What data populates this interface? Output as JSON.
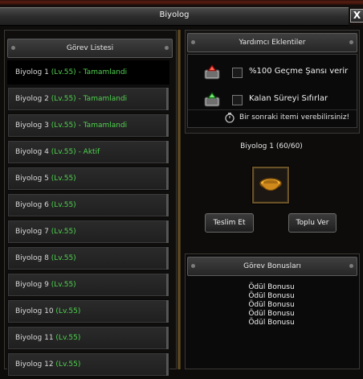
{
  "window": {
    "title": "Biyolog",
    "close_label": "X"
  },
  "left": {
    "header": "Görev Listesi",
    "quests": [
      {
        "name": "Biyolog 1",
        "level": "(Lv.55)",
        "status": "- Tamamlandi"
      },
      {
        "name": "Biyolog 2",
        "level": "(Lv.55)",
        "status": "- Tamamlandi"
      },
      {
        "name": "Biyolog 3",
        "level": "(Lv.55)",
        "status": "- Tamamlandi"
      },
      {
        "name": "Biyolog 4",
        "level": "(Lv.55)",
        "status": "- Aktif"
      },
      {
        "name": "Biyolog 5",
        "level": "(Lv.55)",
        "status": ""
      },
      {
        "name": "Biyolog 6",
        "level": "(Lv.55)",
        "status": ""
      },
      {
        "name": "Biyolog 7",
        "level": "(Lv.55)",
        "status": ""
      },
      {
        "name": "Biyolog 8",
        "level": "(Lv.55)",
        "status": ""
      },
      {
        "name": "Biyolog 9",
        "level": "(Lv.55)",
        "status": ""
      },
      {
        "name": "Biyolog 10",
        "level": "(Lv.55)",
        "status": ""
      },
      {
        "name": "Biyolog 11",
        "level": "(Lv.55)",
        "status": ""
      },
      {
        "name": "Biyolog 12",
        "level": "(Lv.55)",
        "status": ""
      }
    ]
  },
  "helpers": {
    "header": "Yardımcı Eklentiler",
    "items": [
      {
        "label": "%100 Geçme Şansı verir",
        "icon": "red-gem-icon"
      },
      {
        "label": "Kalan Süreyi Sıfırlar",
        "icon": "green-gem-icon"
      }
    ],
    "timer_text": "Bir sonraki itemi verebilirsiniz!"
  },
  "quest": {
    "title": "Biyolog 1 (60/60)"
  },
  "buttons": {
    "deliver": "Teslim Et",
    "bulk": "Toplu Ver"
  },
  "bonus": {
    "header": "Görev Bonusları",
    "items": [
      "Ödül Bonusu",
      "Ödül Bonusu",
      "Ödül Bonusu",
      "Ödül Bonusu",
      "Ödül Bonusu"
    ]
  },
  "colors": {
    "accent_green": "#4fd24f",
    "frame_gold": "#6a5228"
  }
}
